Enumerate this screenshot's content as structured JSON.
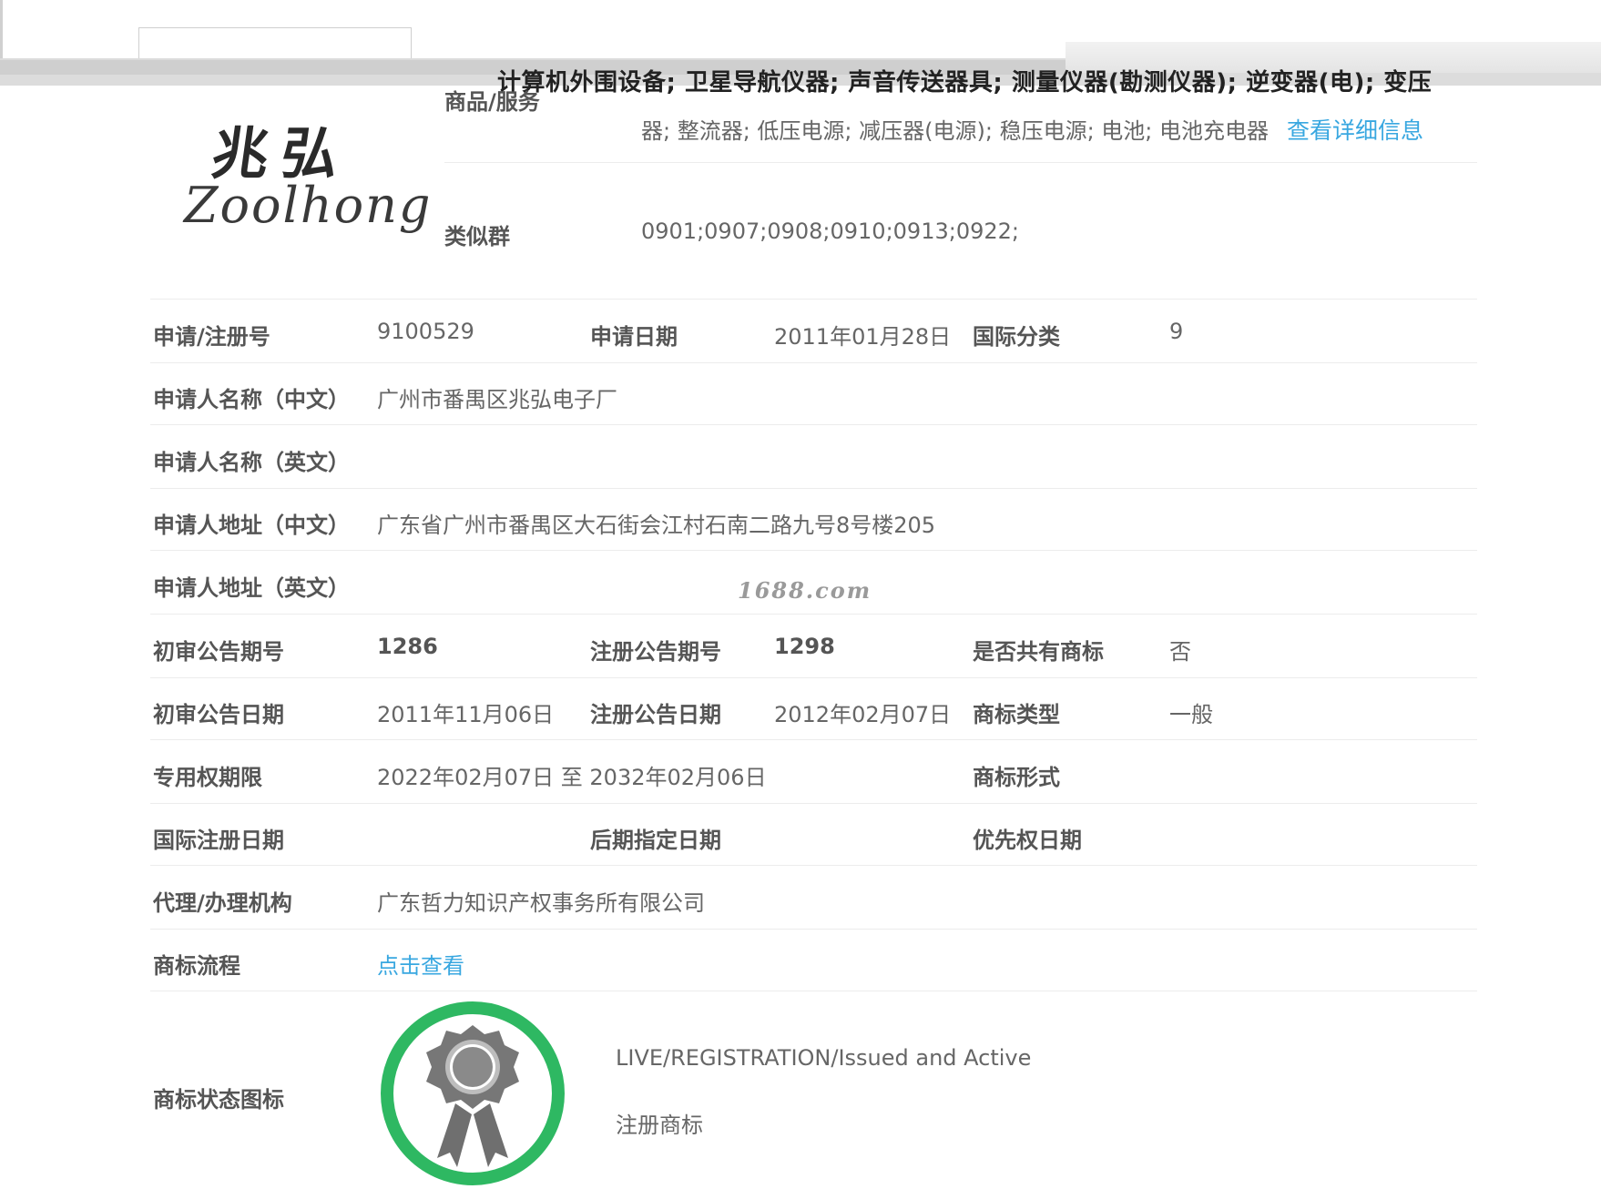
{
  "top_strip": {
    "goods_line1": "计算机外围设备; 卫星导航仪器; 声音传送器具; 测量仪器(勘测仪器); 逆变器(电); 变压"
  },
  "logo": {
    "chinese": "兆弘",
    "english": "Zoolhong"
  },
  "goods": {
    "label": "商品/服务",
    "line2": "器; 整流器; 低压电源; 减压器(电源); 稳压电源; 电池; 电池充电器",
    "detail_link": "查看详细信息"
  },
  "similar_group": {
    "label": "类似群",
    "value": "0901;0907;0908;0910;0913;0922;"
  },
  "reg_no": {
    "label": "申请/注册号",
    "value": "9100529"
  },
  "apply_date": {
    "label": "申请日期",
    "value": "2011年01月28日"
  },
  "intl_class": {
    "label": "国际分类",
    "value": "9"
  },
  "applicant_cn": {
    "label": "申请人名称（中文）",
    "value": "广州市番禺区兆弘电子厂"
  },
  "applicant_en": {
    "label": "申请人名称（英文）",
    "value": ""
  },
  "address_cn": {
    "label": "申请人地址（中文）",
    "value": "广东省广州市番禺区大石街会江村石南二路九号8号楼205"
  },
  "address_en": {
    "label": "申请人地址（英文）",
    "value": ""
  },
  "watermark": "1688.com",
  "prelim_issue_no": {
    "label": "初审公告期号",
    "value": "1286"
  },
  "reg_issue_no": {
    "label": "注册公告期号",
    "value": "1298"
  },
  "shared_mark": {
    "label": "是否共有商标",
    "value": "否"
  },
  "prelim_date": {
    "label": "初审公告日期",
    "value": "2011年11月06日"
  },
  "reg_date": {
    "label": "注册公告日期",
    "value": "2012年02月07日"
  },
  "mark_type": {
    "label": "商标类型",
    "value": "一般"
  },
  "validity": {
    "label": "专用权期限",
    "value": "2022年02月07日 至 2032年02月06日"
  },
  "mark_form": {
    "label": "商标形式",
    "value": ""
  },
  "intl_reg_date": {
    "label": "国际注册日期",
    "value": ""
  },
  "later_designation": {
    "label": "后期指定日期",
    "value": ""
  },
  "priority_date": {
    "label": "优先权日期",
    "value": ""
  },
  "agency": {
    "label": "代理/办理机构",
    "value": "广东哲力知识产权事务所有限公司"
  },
  "flow": {
    "label": "商标流程",
    "link": "点击查看"
  },
  "status": {
    "label": "商标状态图标",
    "en": "LIVE/REGISTRATION/Issued and Active",
    "cn": "注册商标",
    "ring_color": "#2eb862",
    "medal_color": "#777777"
  }
}
